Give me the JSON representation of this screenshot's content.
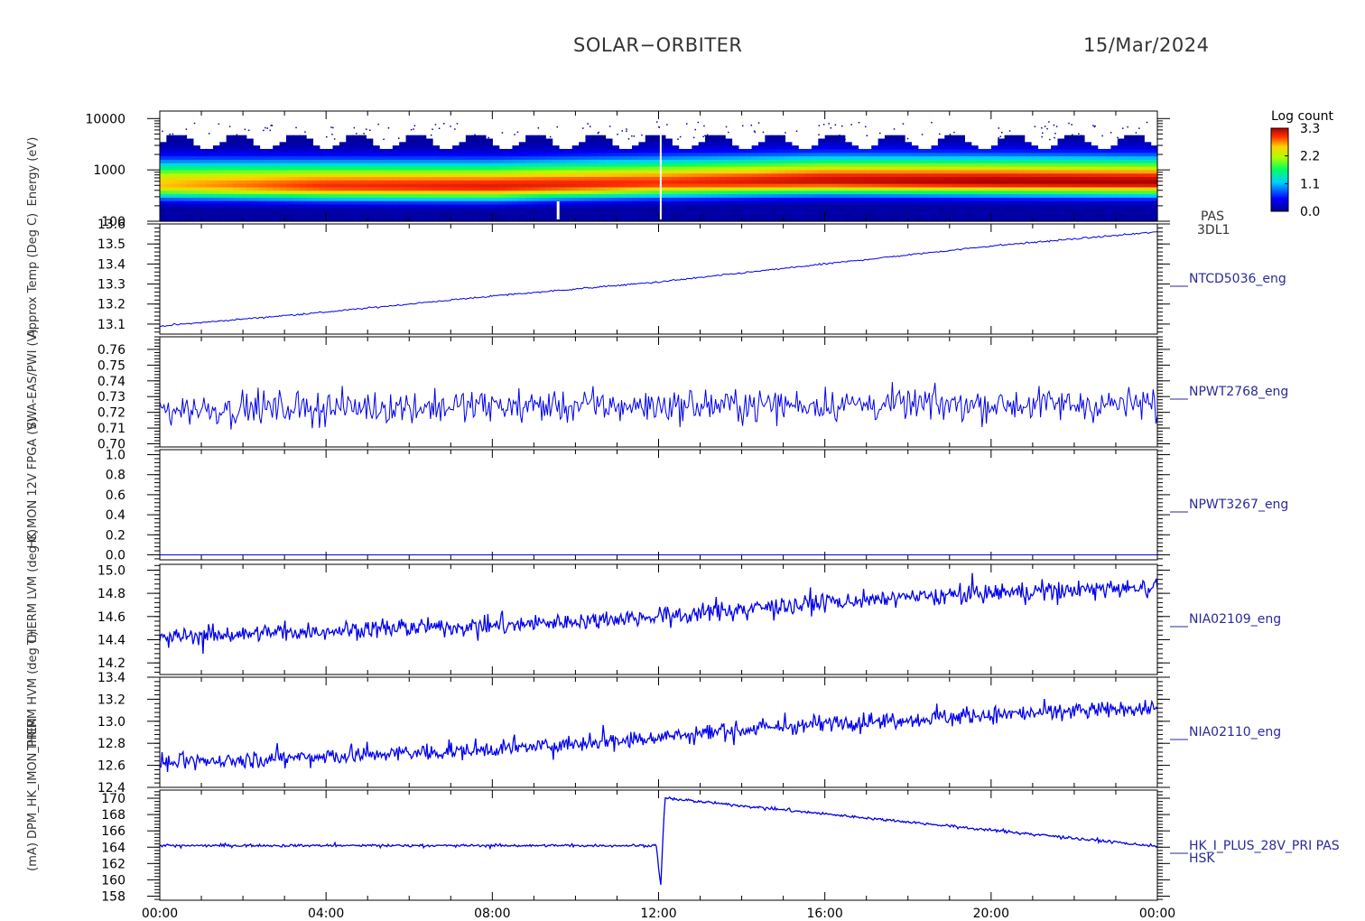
{
  "header": {
    "mission": "SOLAR−ORBITER",
    "date": "15/Mar/2024"
  },
  "time_axis": {
    "ticks": [
      "00:00",
      "04:00",
      "08:00",
      "12:00",
      "16:00",
      "20:00",
      "00:00"
    ],
    "range_hours": [
      0,
      24
    ]
  },
  "colorbar": {
    "title": "Log count",
    "ticks": [
      "0.0",
      "1.1",
      "2.2",
      "3.3"
    ],
    "range": [
      0.0,
      3.3
    ]
  },
  "overlapping_ylabels": [
    "Energy (eV)",
    "Approx Temp (Deg C)",
    "SWA-EAS/PWI (V)",
    "HK MON 12V FPGA (V)",
    "THERM LVM (deg C)",
    "THERM HVM (deg C)",
    "(mA) DPM_HK_IMON_PRIM"
  ],
  "colors": {
    "trace": "#0000ee",
    "label": "#2a2a9a",
    "axis": "#000000"
  },
  "chart_data": [
    {
      "type": "heatmap",
      "name": "PAS 3DL1",
      "labels": [
        "PAS",
        "3DL1"
      ],
      "ylabel": "Energy (eV)",
      "yscale": "log",
      "ylim": [
        100,
        14000
      ],
      "yticks": [
        "100",
        "1000",
        "10000"
      ],
      "z_label": "Log count",
      "zlim": [
        0.0,
        3.3
      ],
      "description_points": [
        {
          "hour": 0,
          "peak_energy": 520,
          "peak_log": 2.6
        },
        {
          "hour": 4,
          "peak_energy": 490,
          "peak_log": 3.0
        },
        {
          "hour": 8,
          "peak_energy": 480,
          "peak_log": 3.1
        },
        {
          "hour": 12,
          "peak_energy": 560,
          "peak_log": 3.0
        },
        {
          "hour": 16,
          "peak_energy": 620,
          "peak_log": 3.2
        },
        {
          "hour": 20,
          "peak_energy": 600,
          "peak_log": 3.3
        },
        {
          "hour": 24,
          "peak_energy": 580,
          "peak_log": 3.3
        }
      ]
    },
    {
      "type": "line",
      "name": "NTCD5036_eng",
      "labels": [
        "NTCD5036_eng"
      ],
      "ylim": [
        13.05,
        13.6
      ],
      "yticks": [
        "13.1",
        "13.2",
        "13.3",
        "13.4",
        "13.5",
        "13.6"
      ],
      "ytick_values": [
        13.1,
        13.2,
        13.3,
        13.4,
        13.5,
        13.6
      ],
      "x": [
        0,
        4,
        8,
        12,
        16,
        20,
        24
      ],
      "y": [
        13.09,
        13.16,
        13.24,
        13.31,
        13.4,
        13.49,
        13.56
      ],
      "noise": 0.004
    },
    {
      "type": "line",
      "name": "NPWT2768_eng",
      "labels": [
        "NPWT2768_eng"
      ],
      "ylim": [
        0.698,
        0.768
      ],
      "yticks": [
        "0.70",
        "0.71",
        "0.72",
        "0.73",
        "0.74",
        "0.75",
        "0.76"
      ],
      "ytick_values": [
        0.7,
        0.71,
        0.72,
        0.73,
        0.74,
        0.75,
        0.76
      ],
      "x": [
        0,
        4,
        8,
        12,
        16,
        20,
        24
      ],
      "y": [
        0.722,
        0.723,
        0.724,
        0.724,
        0.725,
        0.725,
        0.725
      ],
      "noise": 0.01
    },
    {
      "type": "line",
      "name": "NPWT3267_eng",
      "labels": [
        "NPWT3267_eng"
      ],
      "ylim": [
        -0.05,
        1.05
      ],
      "yticks": [
        "0.0",
        "0.2",
        "0.4",
        "0.6",
        "0.8",
        "1.0"
      ],
      "ytick_values": [
        0.0,
        0.2,
        0.4,
        0.6,
        0.8,
        1.0
      ],
      "x": [
        0,
        24
      ],
      "y": [
        0.0,
        0.0
      ],
      "noise": 0.0
    },
    {
      "type": "line",
      "name": "NIA02109_eng",
      "labels": [
        "NIA02109_eng"
      ],
      "ylim": [
        14.1,
        15.05
      ],
      "yticks": [
        "14.2",
        "14.4",
        "14.6",
        "14.8",
        "15.0"
      ],
      "ytick_values": [
        14.2,
        14.4,
        14.6,
        14.8,
        15.0
      ],
      "x": [
        0,
        4,
        8,
        12,
        16,
        20,
        24
      ],
      "y": [
        14.42,
        14.48,
        14.52,
        14.6,
        14.72,
        14.8,
        14.86
      ],
      "noise": 0.07
    },
    {
      "type": "line",
      "name": "NIA02110_eng",
      "labels": [
        "NIA02110_eng"
      ],
      "ylim": [
        12.4,
        13.4
      ],
      "yticks": [
        "12.4",
        "12.6",
        "12.8",
        "13.0",
        "13.2",
        "13.4"
      ],
      "ytick_values": [
        12.4,
        12.6,
        12.8,
        13.0,
        13.2,
        13.4
      ],
      "x": [
        0,
        4,
        8,
        12,
        16,
        20,
        24
      ],
      "y": [
        12.62,
        12.68,
        12.74,
        12.86,
        12.98,
        13.06,
        13.12
      ],
      "noise": 0.07
    },
    {
      "type": "line",
      "name": "HK_I_PLUS_28V_PRI PAS HSK",
      "labels": [
        "HK_I_PLUS_28V_PRI PAS",
        "HSK"
      ],
      "ylim": [
        157.5,
        171
      ],
      "yticks": [
        "158",
        "160",
        "162",
        "164",
        "166",
        "168",
        "170"
      ],
      "ytick_values": [
        158,
        160,
        162,
        164,
        166,
        168,
        170
      ],
      "x": [
        0,
        11.95,
        12.05,
        12.15,
        24
      ],
      "y": [
        164.2,
        164.2,
        159.0,
        170.0,
        164.1
      ],
      "noise": 0.15
    }
  ]
}
